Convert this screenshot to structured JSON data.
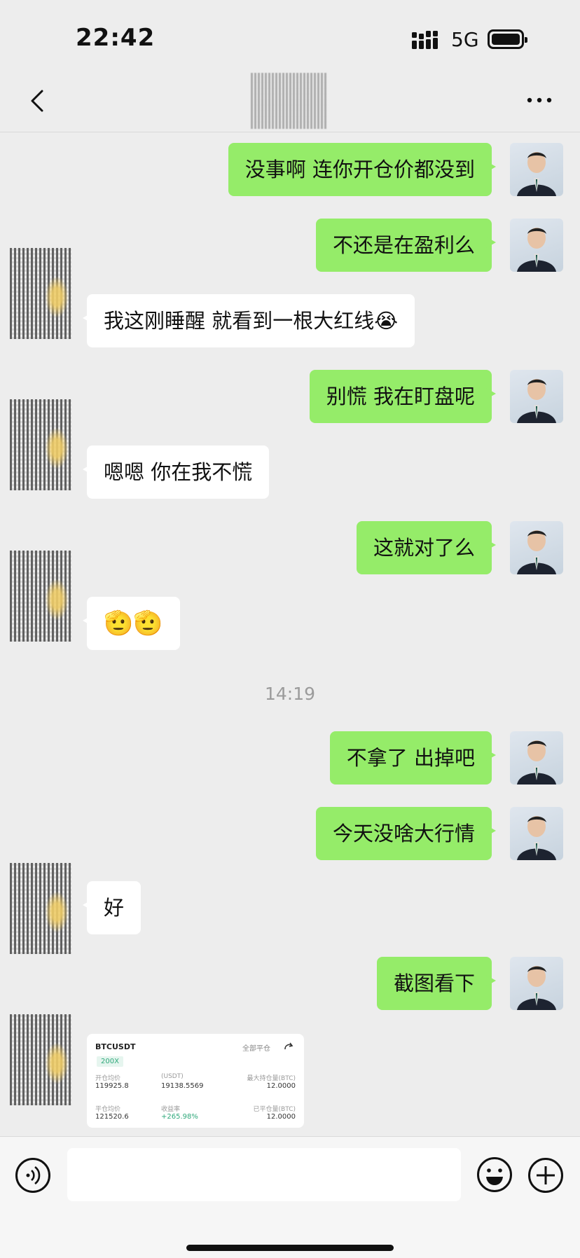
{
  "status_bar": {
    "time": "22:42",
    "network": "5G"
  },
  "nav": {
    "back_icon": "chevron-left-icon",
    "more_icon": "more-icon"
  },
  "messages": [
    {
      "side": "out",
      "text": "没事啊 连你开仓价都没到"
    },
    {
      "side": "out",
      "text": "不还是在盈利么"
    },
    {
      "side": "in",
      "text": "我这刚睡醒 就看到一根大红线😭"
    },
    {
      "side": "out",
      "text": "别慌 我在盯盘呢"
    },
    {
      "side": "in",
      "text": "嗯嗯 你在我不慌"
    },
    {
      "side": "out",
      "text": "这就对了么"
    },
    {
      "side": "in",
      "text": "🫡🫡"
    },
    {
      "side": "out",
      "text": "不拿了 出掉吧"
    },
    {
      "side": "out",
      "text": "今天没啥大行情"
    },
    {
      "side": "in",
      "text": "好"
    },
    {
      "side": "out",
      "text": "截图看下"
    }
  ],
  "timestamp": "14:19",
  "trade_card": {
    "symbol": "BTCUSDT",
    "leverage": "200X",
    "close_all": "全部平仓",
    "open_avg_label": "开仓均价",
    "open_avg_value": "119925.8",
    "usdt_label": "(USDT)",
    "usdt_value": "19138.5569",
    "max_hold_label": "最大持仓量(BTC)",
    "max_hold_value": "12.0000",
    "close_avg_label": "平仓均价",
    "close_avg_value": "121520.6",
    "yield_label": "收益率",
    "yield_value": "+265.98%",
    "closed_qty_label": "已平仓量(BTC)",
    "closed_qty_value": "12.0000"
  },
  "input": {
    "placeholder": ""
  },
  "colors": {
    "out_bubble": "#95ec69",
    "in_bubble": "#ffffff",
    "background": "#ededed"
  }
}
